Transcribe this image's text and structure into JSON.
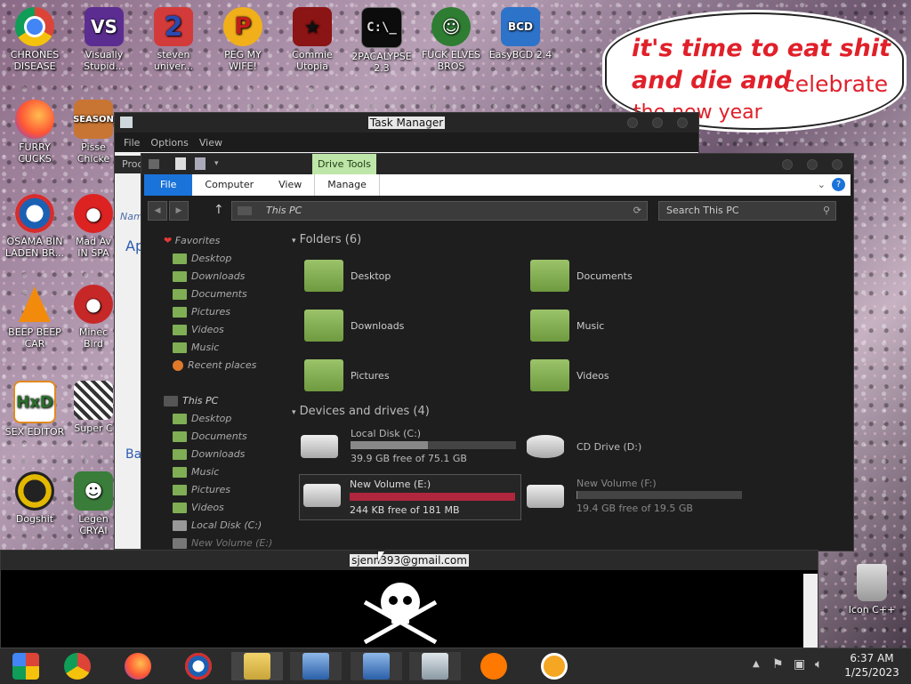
{
  "desktop_icons": [
    {
      "label": "CHRONES DISEASE",
      "icon": "chrome-icon"
    },
    {
      "label": "Visually Stupid...",
      "icon": "visual-studio-icon"
    },
    {
      "label": "steven univer...",
      "icon": "steven-universe-icon"
    },
    {
      "label": "PEG MY WIFE!",
      "icon": "peggle-icon"
    },
    {
      "label": "Commie Utopia",
      "icon": "commie-icon"
    },
    {
      "label": "2PACALYPSE 2.3",
      "icon": "cmd-icon"
    },
    {
      "label": "FUCK ELVES BROS",
      "icon": "elf-icon"
    },
    {
      "label": "EasyBCD 2.4",
      "icon": "easybcd-icon"
    },
    {
      "label": "FURRY CUCKS",
      "icon": "firefox-icon"
    },
    {
      "label": "Pisse Chicke",
      "icon": "game-icon"
    },
    {
      "label": "OSAMA BIN LADEN BR...",
      "icon": "obama-icon"
    },
    {
      "label": "Mad Av IN SPA",
      "icon": "angry-birds-icon"
    },
    {
      "label": "BEEP BEEP CAR",
      "icon": "vlc-icon"
    },
    {
      "label": "Minec Bird",
      "icon": "angry-bird-red-icon"
    },
    {
      "label": "SEX EDITOR",
      "icon": "hxd-icon"
    },
    {
      "label": "Super C",
      "icon": "super-icon"
    },
    {
      "label": "Dogshit",
      "icon": "dogshit-icon"
    },
    {
      "label": "Legen CRYAI",
      "icon": "legend-icon"
    },
    {
      "label": "Icon C++",
      "icon": "recycle-bin-icon"
    }
  ],
  "speech_bubble": {
    "line1": "it's time to eat shit",
    "line2": "and die and",
    "line2b": "celebrate",
    "line3": "the new year"
  },
  "task_manager": {
    "title": "Task Manager",
    "menu": [
      "File",
      "Options",
      "View"
    ],
    "tab": "Proc"
  },
  "explorer": {
    "drive_tools": "Drive Tools",
    "tabs": [
      "File",
      "Computer",
      "View",
      "Manage"
    ],
    "address": "This PC",
    "search_placeholder": "Search This PC",
    "nav": {
      "favorites": "Favorites",
      "fav_items": [
        "Desktop",
        "Downloads",
        "Documents",
        "Pictures",
        "Videos",
        "Music",
        "Recent places"
      ],
      "this_pc": "This PC",
      "pc_items": [
        "Desktop",
        "Documents",
        "Downloads",
        "Music",
        "Pictures",
        "Videos",
        "Local Disk (C:)",
        "New Volume (E:)"
      ]
    },
    "folders_header": "Folders (6)",
    "folders": [
      "Desktop",
      "Documents",
      "Downloads",
      "Music",
      "Pictures",
      "Videos"
    ],
    "devices_header": "Devices and drives (4)",
    "drives": [
      {
        "name": "Local Disk (C:)",
        "free": "39.9 GB free of 75.1 GB",
        "used_fraction": 0.47,
        "color": "#888888"
      },
      {
        "name": "CD Drive (D:)",
        "free": "",
        "used_fraction": null,
        "color": ""
      },
      {
        "name": "New Volume (E:)",
        "free": "244 KB free of 181 MB",
        "used_fraction": 0.999,
        "color": "#b0263c"
      },
      {
        "name": "New Volume (F:)",
        "free": "19.4 GB free of 19.5 GB",
        "used_fraction": 0.005,
        "color": "#888888"
      }
    ]
  },
  "bottom_window": {
    "title": "sjenn393@gmail.com"
  },
  "clock": {
    "time": "6:37 AM",
    "date": "1/25/2023"
  },
  "sidebar_letters": [
    "Nam",
    "Ap",
    "Ba"
  ]
}
